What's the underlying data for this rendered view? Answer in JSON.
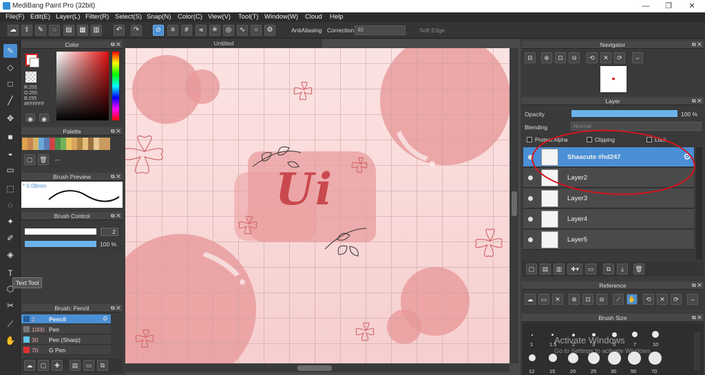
{
  "window": {
    "title": "MediBang Paint Pro (32bit)",
    "minimize": "—",
    "maximize": "❐",
    "close": "✕"
  },
  "menu": [
    "File(F)",
    "Edit(E)",
    "Layer(L)",
    "Filter(R)",
    "Select(S)",
    "Snap(N)",
    "Color(C)",
    "View(V)",
    "Tool(T)",
    "Window(W)",
    "Cloud",
    "Help"
  ],
  "toolbar": {
    "antialiasing_label": "AntiAliasing",
    "correction_label": "Correction",
    "correction_value": "40",
    "soft_edge_label": "Soft Edge"
  },
  "color_panel": {
    "title": "Color",
    "r": "R:255",
    "g": "G:255",
    "b": "B:255",
    "hex": "#FFFFFF"
  },
  "palette_panel": {
    "title": "Palette",
    "name": "---"
  },
  "brush_preview": {
    "title": "Brush Preview",
    "size": "* 0.08mm"
  },
  "brush_control": {
    "title": "Brush Control",
    "size_value": "2",
    "opacity_value": "100 %"
  },
  "brush_panel": {
    "title": "Brush: Pencil",
    "items": [
      {
        "num": "2",
        "name": "Pencil"
      },
      {
        "num": "1000",
        "name": "Pen"
      },
      {
        "num": "30",
        "name": "Pen (Sharp)"
      },
      {
        "num": "70",
        "name": "G Pen"
      }
    ]
  },
  "tooltip": "Text Tool",
  "canvas": {
    "tab_title": "Untitled",
    "art_text": "Ui"
  },
  "navigator": {
    "title": "Navigator"
  },
  "layer_panel": {
    "title": "Layer",
    "opacity_label": "Opacity",
    "opacity_value": "100 %",
    "blending_label": "Blending",
    "blending_value": "Normal",
    "protect_alpha_label": "Protect Alpha",
    "clipping_label": "Clipping",
    "lock_label": "Lock",
    "layers": [
      "Shaacute #hd247",
      "Layer2",
      "Layer3",
      "Layer4",
      "Layer5"
    ]
  },
  "reference": {
    "title": "Reference"
  },
  "brush_size": {
    "title": "Brush Size",
    "row1": [
      "1",
      "1.5",
      "2",
      "3",
      "5",
      "7",
      "10"
    ],
    "row2": [
      "12",
      "15",
      "20",
      "25",
      "30",
      "50",
      "70"
    ]
  },
  "watermark": {
    "line1": "Activate Windows",
    "line2": "Go to Settings to activate Windows."
  }
}
